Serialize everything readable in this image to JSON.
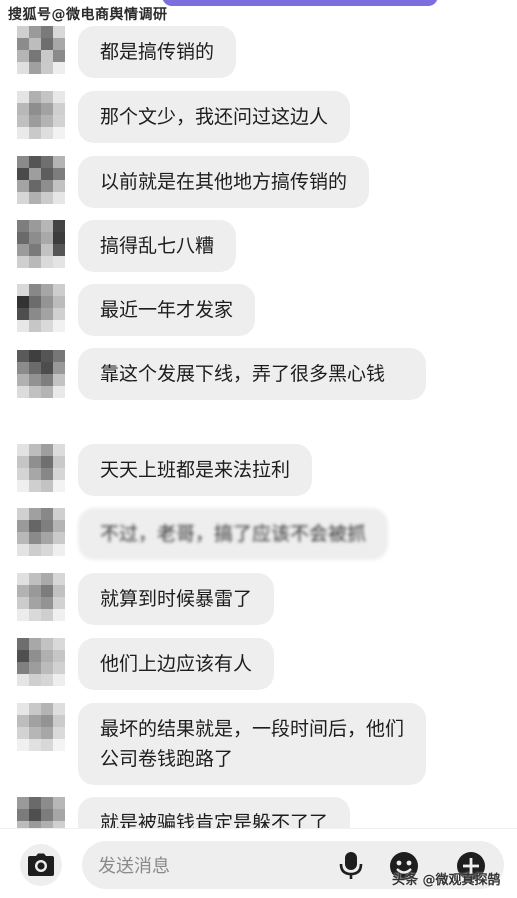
{
  "watermark_top": "搜狐号@微电商舆情调研",
  "messages": [
    {
      "text": "都是搞传销的"
    },
    {
      "text": "那个文少，我还问过这边人"
    },
    {
      "text": "以前就是在其他地方搞传销的"
    },
    {
      "text": "搞得乱七八糟"
    },
    {
      "text": "最近一年才发家"
    },
    {
      "text": "靠这个发展下线，弄了很多黑心钱"
    },
    {
      "text": "天天上班都是来法拉利"
    },
    {
      "text": "不过，老哥，搞了应该不会被抓"
    },
    {
      "text": "就算到时候暴雷了"
    },
    {
      "text": "他们上边应该有人"
    },
    {
      "text": "最坏的结果就是，一段时间后，他们公司卷钱跑路了"
    },
    {
      "text": "就是被骗钱肯定是躲不了了"
    }
  ],
  "composer": {
    "placeholder": "发送消息",
    "icons": [
      "camera-icon",
      "microphone-icon",
      "emoji-icon",
      "plus-icon"
    ]
  },
  "watermark_bottom": "头条 @微观真探鹄",
  "colors": {
    "bubble": "#eeeeef",
    "accent_pill": "#7b6fe0",
    "icon": "#1e1e1e"
  }
}
